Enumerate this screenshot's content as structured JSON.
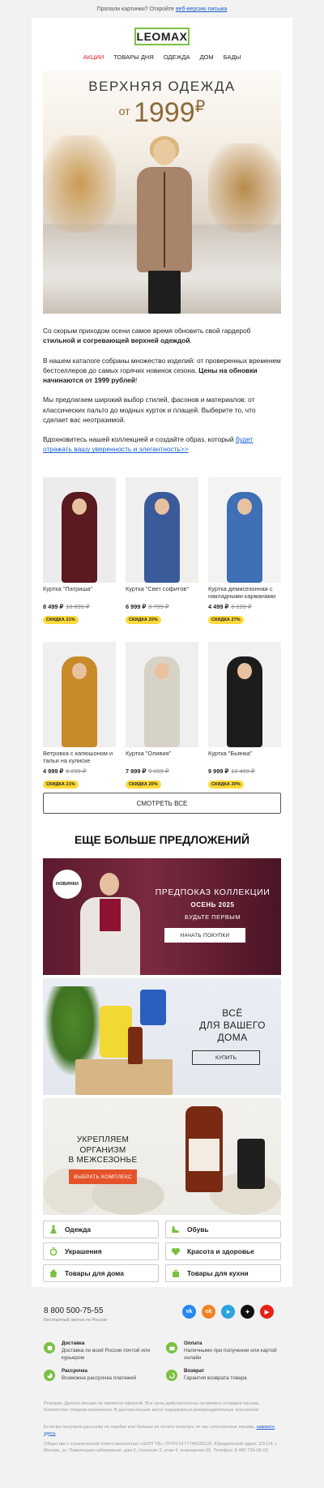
{
  "top_note": {
    "text": "Пропали картинки? Откройте ",
    "link": "веб-версию письма"
  },
  "logo": "LEOMAX",
  "menu": [
    "АКЦИИ",
    "ТОВАРЫ ДНЯ",
    "ОДЕЖДА",
    "ДОМ",
    "БАДЫ"
  ],
  "hero": {
    "title": "ВЕРХНЯЯ ОДЕЖДА",
    "price_from": "от",
    "price": "1999",
    "currency": "₽"
  },
  "intro": {
    "p1_a": "Со скорым приходом осени самое время обновить свой гардероб ",
    "p1_b": "стильной и согревающей верхней одеждой",
    "p1_c": ".",
    "p2_a": "В нашем каталоге собраны множество изделий: от проверенных временем бестселлеров до самых горячих новинок сезона. ",
    "p2_b": "Цены на обновки начинаются от 1999 рублей",
    "p2_c": "!",
    "p3": "Мы предлагаем широкий выбор стилей, фасонов и материалов: от классических пальто до модных курток и плащей. Выберите то, что сделает вас неотразимой.",
    "p4_a": "Вдохновитесь нашей коллекцией и создайте образ, который ",
    "p4_link": "будет отражать вашу уверенность и элегантность>>"
  },
  "products": [
    {
      "name": "Куртка \"Патриша\"",
      "price": "8 499 ₽",
      "old_price": "10 699 ₽",
      "badge": "СКИДКА 21%",
      "color": "#5a1a20"
    },
    {
      "name": "Куртка \"Свет софитов\"",
      "price": "6 999 ₽",
      "old_price": "8 799 ₽",
      "badge": "СКИДКА 20%",
      "color": "#3a5a9a"
    },
    {
      "name": "Куртка демисезонная с накладными карманами",
      "price": "4 499 ₽",
      "old_price": "6 199 ₽",
      "badge": "СКИДКА 27%",
      "color": "#3f6fb5"
    },
    {
      "name": "Ветровка с капюшоном и тальи на кулиске",
      "price": "4 999 ₽",
      "old_price": "6 299 ₽",
      "badge": "СКИДКА 21%",
      "color": "#c98a2a"
    },
    {
      "name": "Куртка \"Оливия\"",
      "price": "7 999 ₽",
      "old_price": "9 999 ₽",
      "badge": "СКИДКА 20%",
      "color": "#d7d2c6"
    },
    {
      "name": "Куртка \"Бьянка\"",
      "price": "9 999 ₽",
      "old_price": "12 499 ₽",
      "badge": "СКИДКА 20%",
      "color": "#1c1c1c"
    }
  ],
  "show_all": "СМОТРЕТЬ ВСЕ",
  "more_title": "ЕЩЕ БОЛЬШЕ ПРЕДЛОЖЕНИЙ",
  "banner1": {
    "sticker": "НОВИНКИ",
    "title": "ПРЕДПОКАЗ КОЛЛЕКЦИИ",
    "season": "ОСЕНЬ 2025",
    "sub": "БУДЬТЕ ПЕРВЫМ",
    "button": "НАЧАТЬ ПОКУПКИ"
  },
  "banner2": {
    "line1": "ВСЁ",
    "line2": "ДЛЯ ВАШЕГО",
    "line3": "ДОМА",
    "button": "КУПИТЬ"
  },
  "banner3": {
    "line1": "УКРЕПЛЯЕМ",
    "line2": "ОРГАНИЗМ",
    "line3": "В МЕЖСЕЗОНЬЕ",
    "button": "ВЫБРАТЬ КОМПЛЕКС"
  },
  "categories": [
    "Одежда",
    "Обувь",
    "Украшения",
    "Красота и здоровье",
    "Товары для дома",
    "Товары для кухни"
  ],
  "footer": {
    "phone": "8 800 500-75-55",
    "phone_note": "Бесплатный звонок по России",
    "socials": [
      "vk",
      "ok",
      "telegram",
      "dzen",
      "youtube"
    ],
    "social_colors": [
      "#2787f5",
      "#f58220",
      "#2aa3e1",
      "#111111",
      "#e62117"
    ],
    "info": [
      {
        "title": "Доставка",
        "text": "Доставка по всей России почтой или курьером"
      },
      {
        "title": "Оплата",
        "text": "Наличными при получении или картой онлайн"
      },
      {
        "title": "Рассрочка",
        "text": "Возможна рассрочка платежей"
      },
      {
        "title": "Возврат",
        "text": "Гарантия возврата товара"
      }
    ],
    "legal1": "Реклама. Данное письмо не является офертой. Все цены действительны на момент отправки письма. Количество товаров ограничено. В данном письме могут содержаться рекомендательные технологии",
    "legal2_a": "Если вы получили рассылку по ошибке или больше не хотите получать от нас электронные письма, ",
    "legal2_link": "нажмите здесь",
    "legal2_c": ".",
    "legal3": "Общество с ограниченной ответственностью «ШОП ТВ», ОГРН 5177746036129. Юридический адрес 115114, г. Москва, ул. Павелецкая набережная, дом 2, строение 2, этаж 4, помещение 60. Телефон: 8 495 733-96-03."
  }
}
